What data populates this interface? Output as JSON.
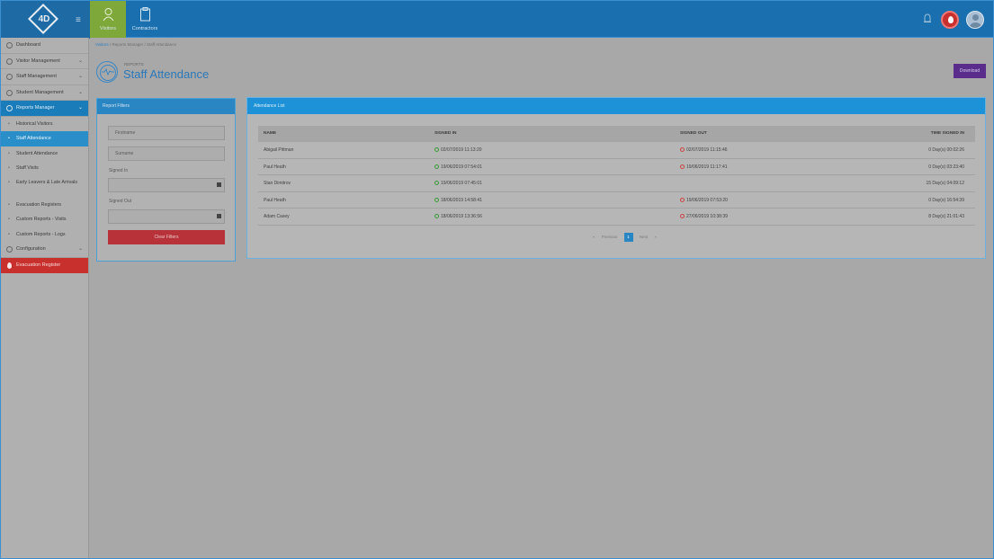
{
  "topbar": {
    "logo_text": "4D",
    "nav": [
      {
        "label": "Visitors"
      },
      {
        "label": "Contractors"
      }
    ]
  },
  "sidebar": {
    "dashboard": "Dashboard",
    "visitor_management": "Visitor Management",
    "staff_management": "Staff Management",
    "student_management": "Student Management",
    "reports_manager": "Reports Manager",
    "reports_sub": [
      "Historical Visitors",
      "Staff Attendance",
      "Student Attendance",
      "Staff Visits",
      "Early Leavers & Late Arrivals",
      "Evacuation Registers",
      "Custom Reports - Visits",
      "Custom Reports - Logs"
    ],
    "configuration": "Configuration",
    "evacuation_register": "Evacuation Register"
  },
  "breadcrumb": [
    "Visitors",
    "Reports Manager",
    "Staff Attendance"
  ],
  "page": {
    "sup": "REPORTS",
    "title": "Staff Attendance",
    "download_label": "Download"
  },
  "filters": {
    "header": "Report Filters",
    "firstname_placeholder": "Firstname",
    "surname_placeholder": "Surname",
    "signed_in_label": "Signed In",
    "signed_out_label": "Signed Out",
    "clear_label": "Clear Filters"
  },
  "attendance": {
    "header": "Attendance List",
    "columns": [
      "NAME",
      "SIGNED IN",
      "SIGNED OUT",
      "TIME SIGNED IN"
    ],
    "rows": [
      {
        "name": "Abigail Pittman",
        "signed_in": "02/07/2019 11:13:20",
        "signed_out": "02/07/2019 11:15:46",
        "time": "0 Day(s) 00:02:26"
      },
      {
        "name": "Paul Heath",
        "signed_in": "19/06/2019 07:54:01",
        "signed_out": "19/06/2019 11:17:41",
        "time": "0 Day(s) 03:23:40"
      },
      {
        "name": "Stan Dimitrov",
        "signed_in": "19/06/2019 07:45:01",
        "signed_out": "",
        "time": "15 Day(s) 04:09:12"
      },
      {
        "name": "Paul Heath",
        "signed_in": "18/06/2019 14:58:41",
        "signed_out": "19/06/2019 07:53:20",
        "time": "0 Day(s) 16:54:39"
      },
      {
        "name": "Adam Casey",
        "signed_in": "18/06/2019 13:36:56",
        "signed_out": "27/06/2019 10:38:39",
        "time": "8 Day(s) 21:01:43"
      }
    ],
    "pager": {
      "prev": "«",
      "previous": "Previous",
      "current": "1",
      "next": "Next",
      "next_arrow": "»"
    }
  }
}
